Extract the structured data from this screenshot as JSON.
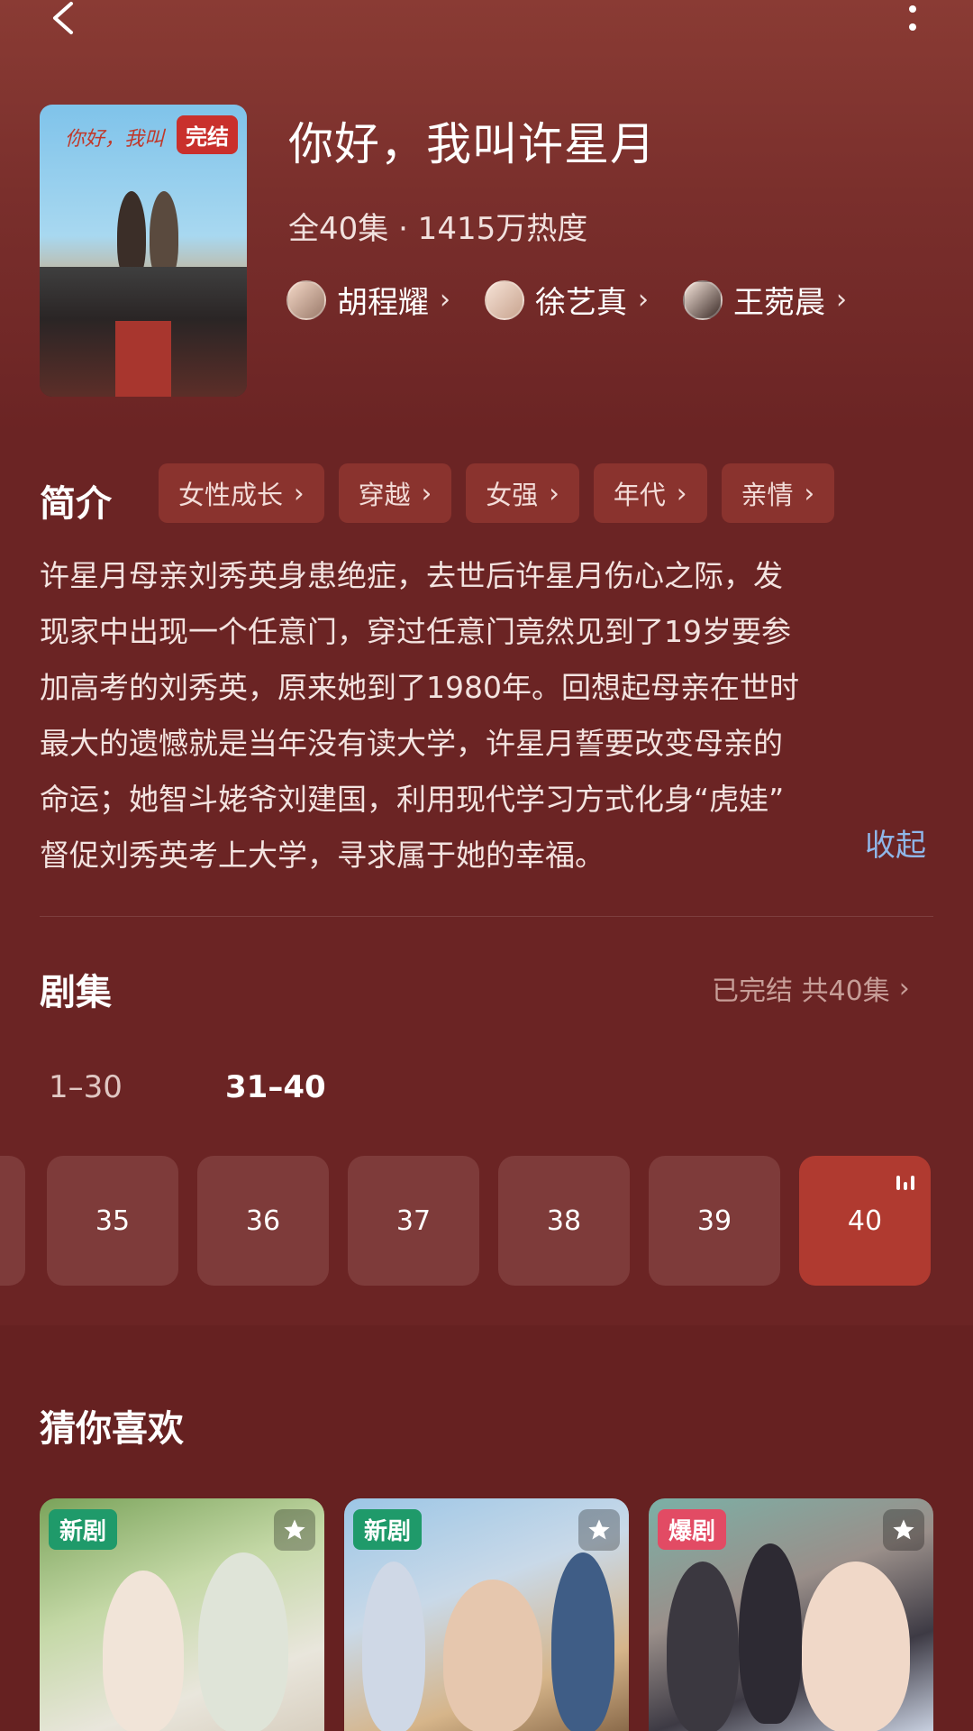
{
  "header": {
    "back_icon": "back-arrow-icon",
    "more_icon": "more-vertical-icon"
  },
  "poster": {
    "badge": "完结",
    "art_title": "你好，我叫"
  },
  "show": {
    "title": "你好，我叫许星月",
    "meta": "全40集 · 1415万热度",
    "cast": [
      {
        "name": "胡程耀"
      },
      {
        "name": "徐艺真"
      },
      {
        "name": "王菀晨"
      }
    ]
  },
  "intro": {
    "heading": "简介",
    "tags": [
      "女性成长",
      "穿越",
      "女强",
      "年代",
      "亲情"
    ],
    "synopsis_lines": [
      "许星月母亲刘秀英身患绝症，去世后许星月伤心之际，发",
      "现家中出现一个任意门，穿过任意门竟然见到了19岁要参",
      "加高考的刘秀英，原来她到了1980年。回想起母亲在世时",
      "最大的遗憾就是当年没有读大学，许星月誓要改变母亲的",
      "命运；她智斗姥爷刘建国，利用现代学习方式化身“虎娃”",
      "督促刘秀英考上大学，寻求属于她的幸福。"
    ],
    "collapse_label": "收起"
  },
  "episodes": {
    "heading": "剧集",
    "summary": "已完结 共40集",
    "ranges": [
      "1–30",
      "31–40"
    ],
    "active_range": "31–40",
    "tiles": [
      "35",
      "36",
      "37",
      "38",
      "39",
      "40"
    ],
    "current": "40"
  },
  "recommend": {
    "heading": "猜你喜欢",
    "cards": [
      {
        "badge": "新剧",
        "badge_color": "#1f9a6a"
      },
      {
        "badge": "新剧",
        "badge_color": "#1f9a6a"
      },
      {
        "badge": "爆剧",
        "badge_color": "#e24b64"
      }
    ]
  },
  "colors": {
    "background": "#6b2424",
    "accent": "#b03a30",
    "tag_bg": "#8a332e",
    "link": "#8fb6e8"
  }
}
